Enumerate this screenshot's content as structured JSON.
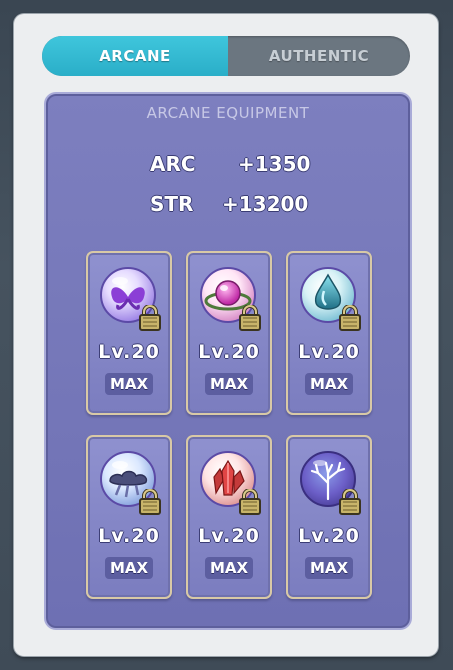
{
  "tabs": {
    "arcane": "ARCANE",
    "authentic": "AUTHENTIC",
    "active": "arcane"
  },
  "panel": {
    "title": "ARCANE EQUIPMENT",
    "stats": [
      {
        "name": "ARC",
        "value": "+1350"
      },
      {
        "name": "STR",
        "value": "+13200"
      }
    ]
  },
  "symbols": [
    {
      "icon": "purple-butterfly-orb-icon",
      "level": "Lv.20",
      "status": "MAX",
      "locked": true
    },
    {
      "icon": "pink-gem-orb-icon",
      "level": "Lv.20",
      "status": "MAX",
      "locked": true
    },
    {
      "icon": "teal-droplet-orb-icon",
      "level": "Lv.20",
      "status": "MAX",
      "locked": true
    },
    {
      "icon": "dark-cloud-orb-icon",
      "level": "Lv.20",
      "status": "MAX",
      "locked": true
    },
    {
      "icon": "red-crystal-orb-icon",
      "level": "Lv.20",
      "status": "MAX",
      "locked": true
    },
    {
      "icon": "white-coral-orb-icon",
      "level": "Lv.20",
      "status": "MAX",
      "locked": true
    }
  ],
  "colors": {
    "active_tab": "#2aaec8",
    "inactive_tab": "#6b7680",
    "panel": "#7577b9",
    "slot_border": "#d8c9a6"
  }
}
